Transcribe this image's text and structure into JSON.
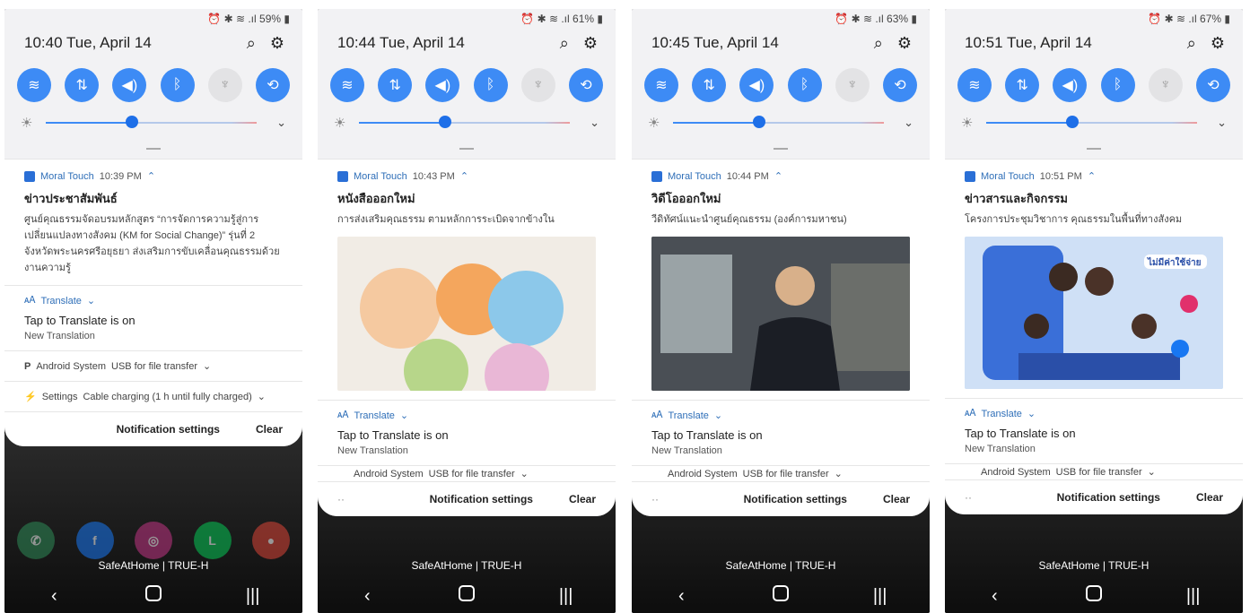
{
  "phones": [
    {
      "status": "59%",
      "time": "10:40  Tue, April 14",
      "notif": {
        "app": "Moral Touch",
        "time": "10:39 PM",
        "title": "ข่าวประชาสัมพันธ์",
        "body": "ศูนย์คุณธรรมจัดอบรมหลักสูตร “การจัดการความรู้สู่การเปลี่ยนแปลงทางสังคม (KM for Social Change)” รุ่นที่ 2 จังหวัดพระนครศรีอยุธยา ส่งเสริมการขับเคลื่อนคุณธรรมด้วยงานความรู้"
      },
      "translate_app": "Translate",
      "translate_title": "Tap to Translate is on",
      "translate_sub": "New Translation",
      "android_app": "Android System",
      "android_text": "USB for file transfer",
      "settings_app": "Settings",
      "settings_text": "Cable charging (1 h until fully charged)",
      "footer_settings": "Notification settings",
      "footer_clear": "Clear",
      "carrier": "SafeAtHome | TRUE-H"
    },
    {
      "status": "61%",
      "time": "10:44  Tue, April 14",
      "notif": {
        "app": "Moral Touch",
        "time": "10:43 PM",
        "title": "หนังสือออกใหม่",
        "body": "การส่งเสริมคุณธรรม ตามหลักการระเบิดจากข้างใน"
      },
      "translate_app": "Translate",
      "translate_title": "Tap to Translate is on",
      "translate_sub": "New Translation",
      "android_app": "Android System",
      "android_text": "USB for file transfer",
      "footer_settings": "Notification settings",
      "footer_clear": "Clear",
      "carrier": "SafeAtHome | TRUE-H"
    },
    {
      "status": "63%",
      "time": "10:45  Tue, April 14",
      "notif": {
        "app": "Moral Touch",
        "time": "10:44 PM",
        "title": "วิดีโอออกใหม่",
        "body": "วีดิทัศน์แนะนำศูนย์คุณธรรม (องค์การมหาชน)"
      },
      "translate_app": "Translate",
      "translate_title": "Tap to Translate is on",
      "translate_sub": "New Translation",
      "android_app": "Android System",
      "android_text": "USB for file transfer",
      "footer_settings": "Notification settings",
      "footer_clear": "Clear",
      "carrier": "SafeAtHome | TRUE-H"
    },
    {
      "status": "67%",
      "time": "10:51  Tue, April 14",
      "notif": {
        "app": "Moral Touch",
        "time": "10:51 PM",
        "title": "ข่าวสารและกิจกรรม",
        "body": "โครงการประชุมวิชาการ คุณธรรมในพื้นที่ทางสังคม"
      },
      "poster_text": "ไม่มีค่าใช้จ่าย",
      "translate_app": "Translate",
      "translate_title": "Tap to Translate is on",
      "translate_sub": "New Translation",
      "android_app": "Android System",
      "android_text": "USB for file transfer",
      "footer_settings": "Notification settings",
      "footer_clear": "Clear",
      "carrier": "SafeAtHome | TRUE-H"
    }
  ],
  "colors": {
    "accent": "#3d8bf5",
    "shade": "#f2f2f4"
  }
}
